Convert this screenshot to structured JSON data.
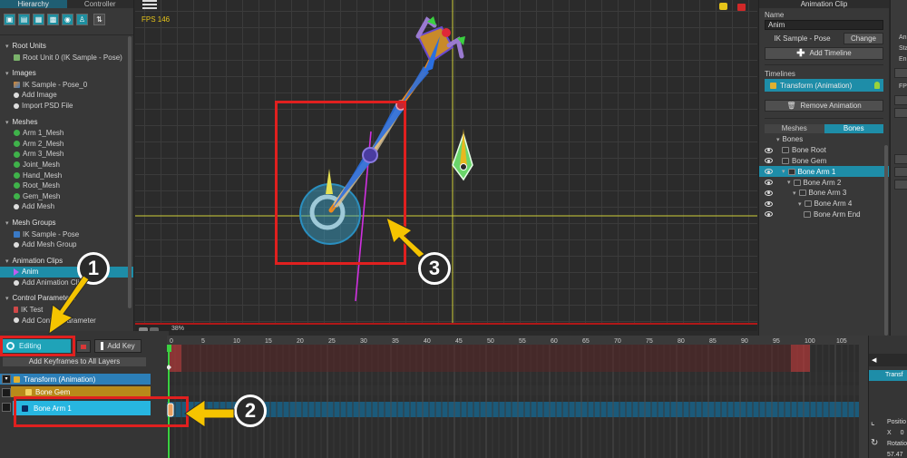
{
  "left_panel": {
    "tabs": [
      "Hierarchy",
      "Controller"
    ],
    "sections": [
      {
        "title": "Root Units",
        "items": [
          {
            "label": "Root Unit 0 (IK Sample - Pose)",
            "icon": "unit-icon"
          }
        ]
      },
      {
        "title": "Images",
        "items": [
          {
            "label": "IK Sample - Pose_0",
            "icon": "image-icon"
          },
          {
            "label": "Add Image",
            "icon": "add-icon"
          },
          {
            "label": "Import PSD File",
            "icon": "add-icon"
          }
        ]
      },
      {
        "title": "Meshes",
        "items": [
          {
            "label": "Arm 1_Mesh",
            "icon": "mesh-icon"
          },
          {
            "label": "Arm 2_Mesh",
            "icon": "mesh-icon"
          },
          {
            "label": "Arm 3_Mesh",
            "icon": "mesh-icon"
          },
          {
            "label": "Joint_Mesh",
            "icon": "mesh-icon"
          },
          {
            "label": "Hand_Mesh",
            "icon": "mesh-icon"
          },
          {
            "label": "Root_Mesh",
            "icon": "mesh-icon"
          },
          {
            "label": "Gem_Mesh",
            "icon": "mesh-icon"
          },
          {
            "label": "Add Mesh",
            "icon": "add-icon"
          }
        ]
      },
      {
        "title": "Mesh Groups",
        "items": [
          {
            "label": "IK Sample - Pose",
            "icon": "meshgroup-icon"
          },
          {
            "label": "Add Mesh Group",
            "icon": "add-icon"
          }
        ]
      },
      {
        "title": "Animation Clips",
        "items": [
          {
            "label": "Anim",
            "icon": "animation-icon",
            "selected": true
          },
          {
            "label": "Add Animation Clip",
            "icon": "add-icon"
          }
        ]
      },
      {
        "title": "Control Parameters",
        "items": [
          {
            "label": "IK Test",
            "icon": "parameter-icon"
          },
          {
            "label": "Add Control Parameter",
            "icon": "add-icon"
          }
        ]
      }
    ]
  },
  "viewport": {
    "fps_label": "FPS 146",
    "zoom_label": "38%"
  },
  "inspector": {
    "title": "Animation Clip",
    "name_label": "Name",
    "name_value": "Anim",
    "target_label": "IK Sample - Pose",
    "change_label": "Change",
    "add_timeline_label": "Add Timeline",
    "timelines_label": "Timelines",
    "timeline_item": "Transform (Animation)",
    "remove_animation_label": "Remove Animation",
    "tabs": [
      "Meshes",
      "Bones"
    ],
    "bones": [
      {
        "label": "Bones",
        "depth": 0,
        "eye": false,
        "tri": true
      },
      {
        "label": "Bone Root",
        "depth": 1,
        "eye": true,
        "tri": false
      },
      {
        "label": "Bone Gem",
        "depth": 1,
        "eye": true,
        "tri": false
      },
      {
        "label": "Bone Arm 1",
        "depth": 1,
        "eye": true,
        "tri": true,
        "selected": true
      },
      {
        "label": "Bone Arm 2",
        "depth": 2,
        "eye": true,
        "tri": true
      },
      {
        "label": "Bone Arm 3",
        "depth": 3,
        "eye": true,
        "tri": true
      },
      {
        "label": "Bone Arm 4",
        "depth": 4,
        "eye": true,
        "tri": true
      },
      {
        "label": "Bone Arm End",
        "depth": 5,
        "eye": true,
        "tri": false
      }
    ]
  },
  "far_right": {
    "labels": [
      "Ani",
      "Sta",
      "En",
      "FP"
    ]
  },
  "timeline": {
    "editing_label": "Editing",
    "add_key_label": "Add Key",
    "add_keyframes_all_label": "Add Keyframes to All Layers",
    "layers": [
      {
        "label": "Transform (Animation)"
      },
      {
        "label": "Bone Gem"
      },
      {
        "label": "Bone Arm 1"
      }
    ],
    "ruler_labels": [
      "0",
      "5",
      "10",
      "15",
      "20",
      "25",
      "30",
      "35",
      "40",
      "45",
      "50",
      "55",
      "60",
      "65",
      "70",
      "75",
      "80",
      "85",
      "90",
      "95",
      "100",
      "105"
    ],
    "right_panel": {
      "tab": "Transf",
      "position_label": "Positio",
      "x_label": "X",
      "x_value": "0",
      "rotation_label": "Rotatio",
      "rotation_value": "57.47"
    }
  },
  "annotations": {
    "one": "1",
    "two": "2",
    "three": "3"
  },
  "colors": {
    "accent": "#1e8da8",
    "highlight_red": "#e0201f",
    "arrow_yellow": "#f5c400"
  }
}
